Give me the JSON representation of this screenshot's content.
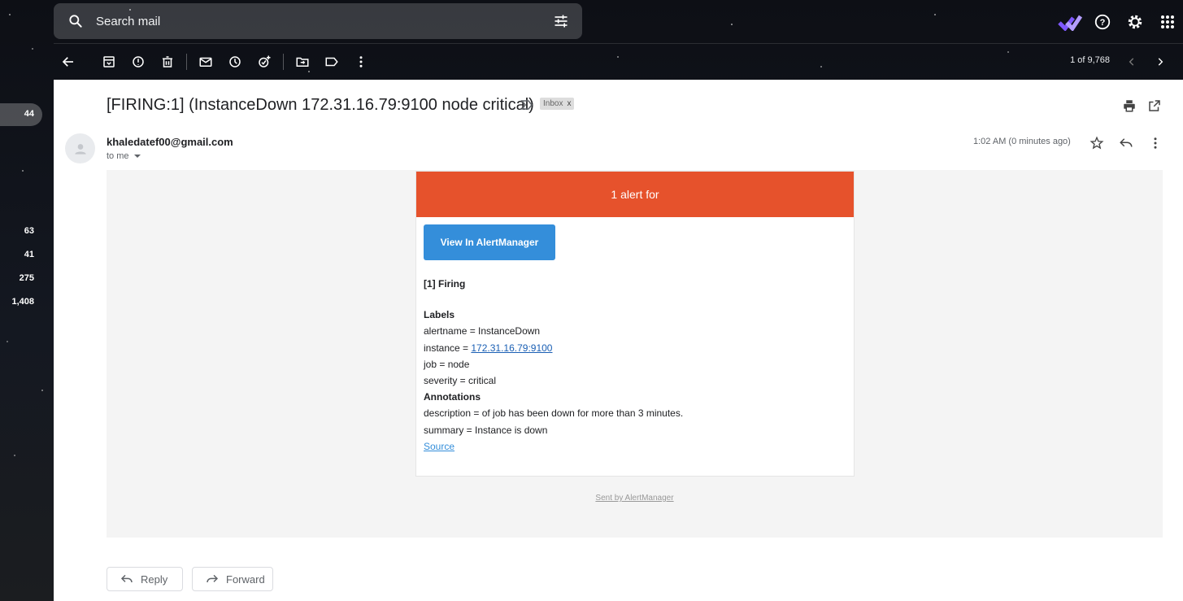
{
  "search": {
    "placeholder": "Search mail"
  },
  "toolbar": {
    "actions": [
      "back",
      "archive",
      "report-spam",
      "delete",
      "mark-unread",
      "snooze",
      "add-to-tasks",
      "move-to",
      "labels",
      "more"
    ],
    "pager_text": "1 of 9,768"
  },
  "rail": {
    "counts": [
      "44",
      "63",
      "41",
      "275",
      "1,408"
    ]
  },
  "email": {
    "subject": "[FIRING:1] (InstanceDown 172.31.16.79:9100 node critical)",
    "label_chip": "Inbox",
    "label_chip_close": "x",
    "sender": "khaledatef00@gmail.com",
    "recipient": "to me",
    "timestamp": "1:02 AM (0 minutes ago)"
  },
  "alert": {
    "header": "1 alert for",
    "button": "View In AlertManager",
    "firing": "[1] Firing",
    "labels_heading": "Labels",
    "alertname": "alertname = InstanceDown",
    "instance_prefix": "instance = ",
    "instance_link": "172.31.16.79:9100",
    "job": "job = node",
    "severity": "severity = critical",
    "annotations_heading": "Annotations",
    "description": "description = of job has been down for more than 3 minutes.",
    "summary": "summary = Instance is down",
    "source": "Source",
    "footer": "Sent by AlertManager",
    "header_color": "#e6522c",
    "button_color": "#348eda"
  },
  "actions": {
    "reply": "Reply",
    "forward": "Forward"
  }
}
